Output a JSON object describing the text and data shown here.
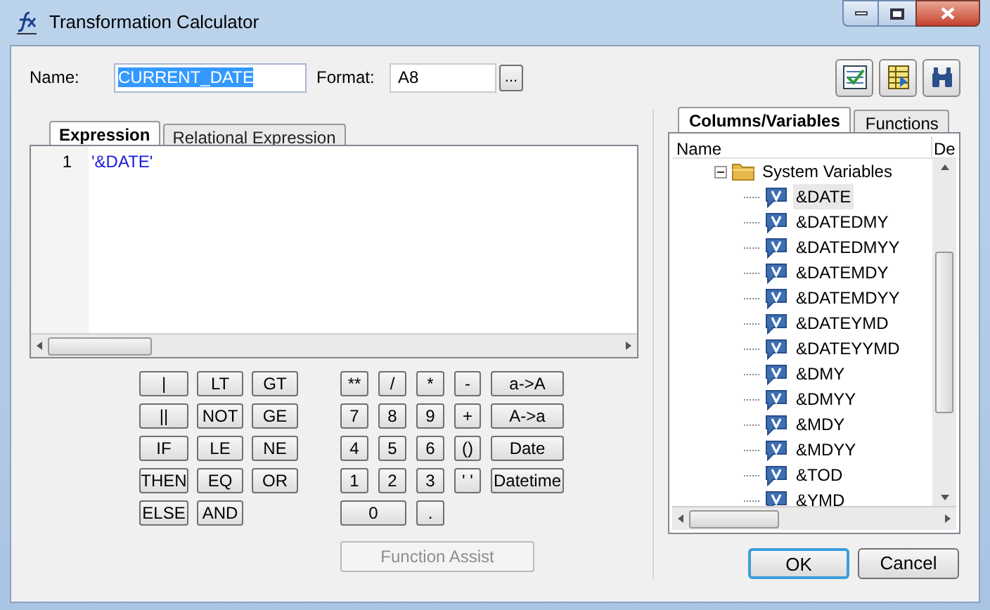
{
  "window": {
    "title": "Transformation Calculator"
  },
  "name_field": {
    "label": "Name:",
    "value": "CURRENT_DATE"
  },
  "format_field": {
    "label": "Format:",
    "value": "A8",
    "browse": "..."
  },
  "editor_tabs": [
    {
      "label": "Expression",
      "selected": true
    },
    {
      "label": "Relational Expression",
      "selected": false
    }
  ],
  "editor": {
    "lines": [
      {
        "number": "1",
        "text": "'&DATE'"
      }
    ]
  },
  "logic_keys": [
    [
      "|",
      "LT",
      "GT"
    ],
    [
      "||",
      "NOT",
      "GE"
    ],
    [
      "IF",
      "LE",
      "NE"
    ],
    [
      "THEN",
      "EQ",
      "OR"
    ],
    [
      "ELSE",
      "AND"
    ]
  ],
  "math_keys": [
    [
      {
        "label": "**",
        "wide": false
      },
      {
        "label": "/",
        "wide": false
      },
      {
        "label": "*",
        "wide": false
      },
      {
        "label": "-",
        "wide": false
      },
      {
        "label": "a->A",
        "wide": false
      }
    ],
    [
      {
        "label": "7",
        "wide": false
      },
      {
        "label": "8",
        "wide": false
      },
      {
        "label": "9",
        "wide": false
      },
      {
        "label": "+",
        "wide": false
      },
      {
        "label": "A->a",
        "wide": false
      }
    ],
    [
      {
        "label": "4",
        "wide": false
      },
      {
        "label": "5",
        "wide": false
      },
      {
        "label": "6",
        "wide": false
      },
      {
        "label": "()",
        "wide": false
      },
      {
        "label": "Date",
        "wide": false
      }
    ],
    [
      {
        "label": "1",
        "wide": false
      },
      {
        "label": "2",
        "wide": false
      },
      {
        "label": "3",
        "wide": false
      },
      {
        "label": "' '",
        "wide": false
      },
      {
        "label": "Datetime",
        "wide": false
      }
    ],
    [
      {
        "label": "0",
        "wide": true
      },
      {
        "label": ".",
        "wide": false
      }
    ]
  ],
  "function_assist": {
    "label": "Function Assist",
    "disabled": true
  },
  "side_tabs": [
    {
      "label": "Columns/Variables",
      "selected": true
    },
    {
      "label": "Functions",
      "selected": false
    }
  ],
  "tree": {
    "columns": [
      "Name",
      "De"
    ],
    "folder": {
      "label": "System Variables",
      "expanded": true,
      "children": [
        {
          "label": "&DATE",
          "selected": true
        },
        {
          "label": "&DATEDMY",
          "selected": false
        },
        {
          "label": "&DATEDMYY",
          "selected": false
        },
        {
          "label": "&DATEMDY",
          "selected": false
        },
        {
          "label": "&DATEMDYY",
          "selected": false
        },
        {
          "label": "&DATEYMD",
          "selected": false
        },
        {
          "label": "&DATEYYMD",
          "selected": false
        },
        {
          "label": "&DMY",
          "selected": false
        },
        {
          "label": "&DMYY",
          "selected": false
        },
        {
          "label": "&MDY",
          "selected": false
        },
        {
          "label": "&MDYY",
          "selected": false
        },
        {
          "label": "&TOD",
          "selected": false
        },
        {
          "label": "&YMD",
          "selected": false
        }
      ]
    }
  },
  "buttons": [
    {
      "label": "OK",
      "default": true
    },
    {
      "label": "Cancel",
      "default": false
    }
  ]
}
